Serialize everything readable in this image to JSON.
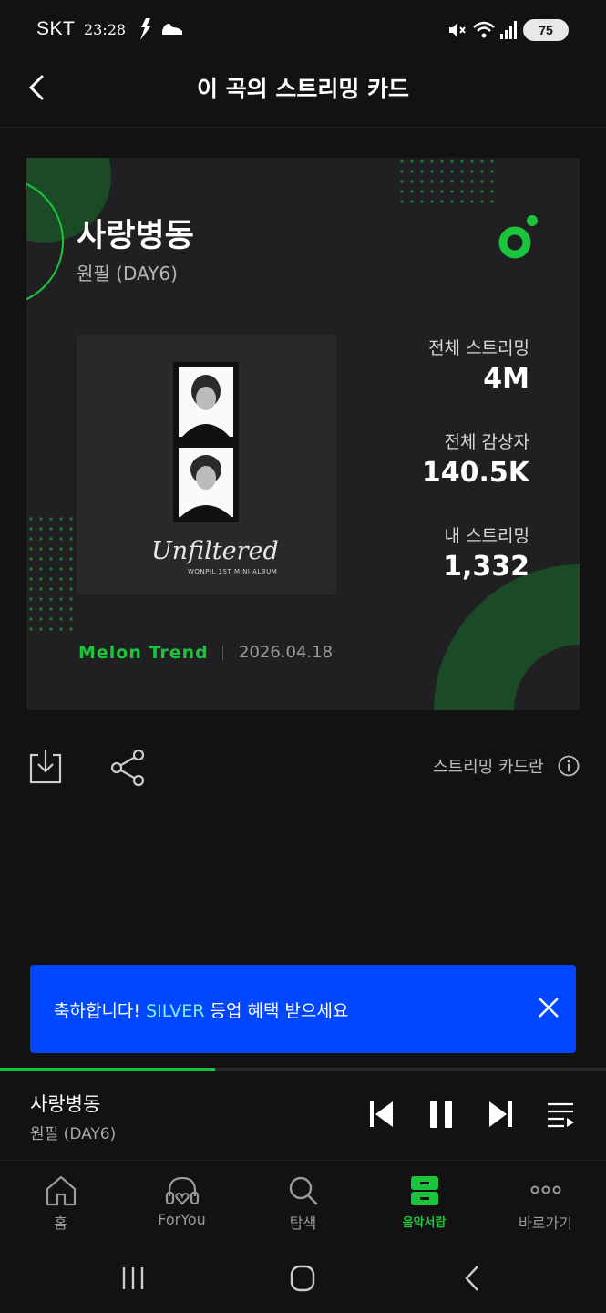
{
  "status_bar": {
    "carrier": "SKT",
    "time": "23:28",
    "battery": "75",
    "icons": [
      "vibrate-icon",
      "shoe-icon",
      "mute-icon",
      "wifi-icon",
      "signal-icon",
      "battery-icon"
    ]
  },
  "header": {
    "title": "이 곡의 스트리밍 카드",
    "back_icon": "chevron-left-icon"
  },
  "card": {
    "song_title": "사랑병동",
    "artist": "원필 (DAY6)",
    "album_script": "Unfiltered",
    "album_sub": "WONPIL 1ST MINI ALBUM",
    "stats": [
      {
        "label": "전체 스트리밍",
        "value": "4M"
      },
      {
        "label": "전체 감상자",
        "value": "140.5K"
      },
      {
        "label": "내 스트리밍",
        "value": "1,332"
      }
    ],
    "brand": "Melon Trend",
    "date": "2026.04.18",
    "colors": {
      "accent": "#1cc43c",
      "card_bg": "#202022",
      "deco_green": "#1a4a26"
    }
  },
  "actions": {
    "download_icon": "download-icon",
    "share_icon": "share-icon",
    "about_label": "스트리밍 카드란",
    "info_icon": "info-icon"
  },
  "banner": {
    "text_before": "축하합니다! ",
    "highlight": "SILVER",
    "text_after": " 등업 혜택 받으세요",
    "close_icon": "close-icon",
    "color": "#0047ff"
  },
  "player": {
    "title": "사랑병동",
    "artist": "원필 (DAY6)",
    "progress": 0.355,
    "controls": [
      "previous-icon",
      "pause-icon",
      "next-icon",
      "playlist-icon"
    ]
  },
  "nav": {
    "items": [
      {
        "label": "홈",
        "icon": "home-icon"
      },
      {
        "label": "ForYou",
        "icon": "headphones-heart-icon"
      },
      {
        "label": "탐색",
        "icon": "search-icon"
      },
      {
        "label": "음악서랍",
        "icon": "drawer-icon",
        "active": true
      },
      {
        "label": "바로가기",
        "icon": "more-icon"
      }
    ]
  },
  "system_nav": [
    "recents-icon",
    "home-circle-icon",
    "back-icon"
  ]
}
